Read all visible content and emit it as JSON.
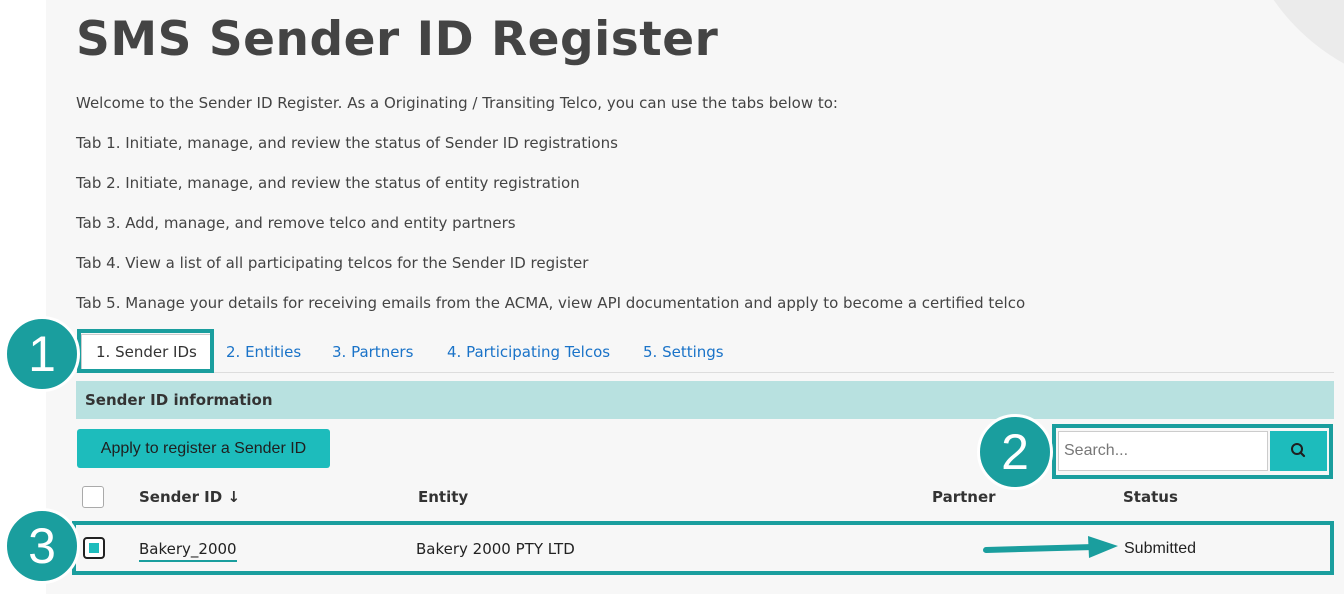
{
  "page": {
    "title": "SMS Sender ID Register",
    "intro": [
      "Welcome to the Sender ID Register. As a Originating / Transiting Telco, you can use the tabs below to:",
      "Tab 1. Initiate, manage, and review the status of Sender ID registrations",
      "Tab 2. Initiate, manage, and review the status of entity registration",
      "Tab 3. Add, manage, and remove telco and entity partners",
      "Tab 4. View a list of all participating telcos for the Sender ID register",
      "Tab 5. Manage your details for receiving emails from the ACMA, view API documentation and apply to become a certified telco"
    ]
  },
  "tabs": [
    {
      "label": "1. Sender IDs",
      "active": true
    },
    {
      "label": "2. Entities"
    },
    {
      "label": "3. Partners"
    },
    {
      "label": "4. Participating Telcos"
    },
    {
      "label": "5. Settings"
    }
  ],
  "section": {
    "heading": "Sender ID information",
    "apply_button": "Apply to register a Sender ID"
  },
  "search": {
    "placeholder": "Search...",
    "icon": "search-icon"
  },
  "table": {
    "columns": {
      "sender_id": "Sender ID ↓",
      "entity": "Entity",
      "partner": "Partner",
      "status": "Status"
    },
    "rows": [
      {
        "sender_id": "Bakery_2000",
        "entity": "Bakery 2000 PTY LTD",
        "partner": "",
        "status": "Submitted",
        "checked": true
      }
    ]
  },
  "annotations": {
    "badges": [
      "1",
      "2",
      "3"
    ],
    "color": "#1a9e9e"
  },
  "colors": {
    "accent": "#1dbcbc",
    "section_bg": "#b8e1e0",
    "link": "#1a73c8",
    "annotation": "#1a9e9e"
  }
}
